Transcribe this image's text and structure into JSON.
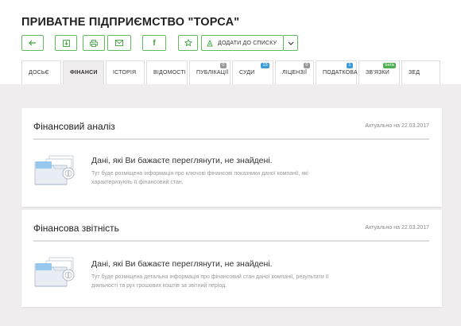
{
  "company": {
    "title": "ПРИВАТНЕ ПІДПРИЄМСТВО \"ТОРСА\""
  },
  "toolbar": {
    "buttons": [
      {
        "icon": "arrow-left-icon"
      },
      {
        "icon": "download-icon"
      },
      {
        "icon": "printer-icon"
      },
      {
        "icon": "mail-icon"
      },
      {
        "icon": "facebook-icon"
      },
      {
        "icon": "star-icon"
      }
    ],
    "add_to_list_label": "ДОДАТИ ДО СПИСКУ",
    "add_to_list_icon": "user-list-icon",
    "dropdown_icon": "chevron-down-icon",
    "accent_color": "#5cbf5c"
  },
  "tabs": [
    {
      "label": "ДОСЬЄ",
      "active": false
    },
    {
      "label": "ФІНАНСИ",
      "active": true
    },
    {
      "label": "ІСТОРІЯ",
      "active": false
    },
    {
      "label": "ВІДОМОСТІ",
      "active": false
    },
    {
      "label": "ПУБЛІКАЦІЇ",
      "badge": "0",
      "badge_color": "#999999"
    },
    {
      "label": "СУДИ",
      "badge": "15",
      "badge_color": "#3d9bdb"
    },
    {
      "label": "ЛІЦЕНЗІЇ",
      "badge": "0",
      "badge_color": "#999999"
    },
    {
      "label": "ПОДАТКОВА",
      "badge": "1",
      "badge_color": "#3d9bdb"
    },
    {
      "label": "ЗВ'ЯЗКИ",
      "badge": "beta",
      "badge_color": "#4cb050"
    },
    {
      "label": "ЗЕД",
      "active": false
    }
  ],
  "sections": [
    {
      "title": "Фінансовий аналіз",
      "date": "Актуально на 22.03.2017",
      "message_title": "Дані, які Ви бажаєте переглянути, не знайдені.",
      "message_desc": "Тут буде розміщена інформація про ключові фінансові показники даної компанії, які характеризують її фінансовий стан.",
      "icon": "empty-folder-icon"
    },
    {
      "title": "Фінансова звітність",
      "date": "Актуально на 22.03.2017",
      "message_title": "Дані, які Ви бажаєте переглянути, не знайдені.",
      "message_desc": "Тут буде розміщена детальна інформація про фінансовий стан даної компанії, результати її діяльності та рух грошових коштів за звітний період.",
      "icon": "empty-folder-icon"
    }
  ]
}
